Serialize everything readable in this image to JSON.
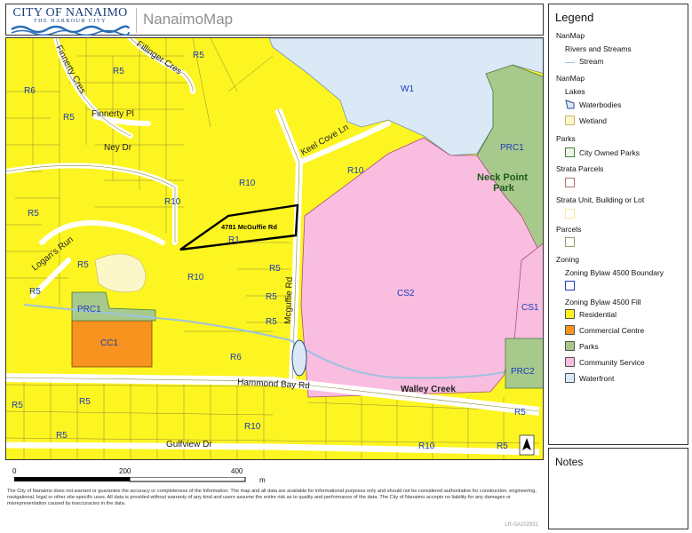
{
  "header": {
    "logo_title": "CITY OF NANAIMO",
    "logo_subtitle": "THE HARBOUR CITY",
    "app_title": "NanaimoMap"
  },
  "map": {
    "zone_labels": [
      {
        "id": "r5-top",
        "text": "R5"
      },
      {
        "id": "r6",
        "text": "R6"
      },
      {
        "id": "r5-left",
        "text": "R5"
      },
      {
        "id": "r5-a",
        "text": "R5"
      },
      {
        "id": "r10-center",
        "text": "R10"
      },
      {
        "id": "r10-mid",
        "text": "R10"
      },
      {
        "id": "r10-keel",
        "text": "R10"
      },
      {
        "id": "r1",
        "text": "R1"
      },
      {
        "id": "r5-logan",
        "text": "R5"
      },
      {
        "id": "r5-b",
        "text": "R5"
      },
      {
        "id": "r5-c",
        "text": "R5"
      },
      {
        "id": "r10-lower",
        "text": "R10"
      },
      {
        "id": "r5-mcg1",
        "text": "R5"
      },
      {
        "id": "r5-mcg2",
        "text": "R5"
      },
      {
        "id": "r5-mcg3",
        "text": "R5"
      },
      {
        "id": "r6-lower",
        "text": "R6"
      },
      {
        "id": "cc1",
        "text": "CC1"
      },
      {
        "id": "prc1-left",
        "text": "PRC1"
      },
      {
        "id": "cs2",
        "text": "CS2"
      },
      {
        "id": "cs1",
        "text": "CS1"
      },
      {
        "id": "prc2",
        "text": "PRC2"
      },
      {
        "id": "w1",
        "text": "W1"
      },
      {
        "id": "prc1-right",
        "text": "PRC1"
      },
      {
        "id": "r5-bl1",
        "text": "R5"
      },
      {
        "id": "r5-bl2",
        "text": "R5"
      },
      {
        "id": "r5-bl3",
        "text": "R5"
      },
      {
        "id": "r10-gulf",
        "text": "R10"
      },
      {
        "id": "r10-br",
        "text": "R10"
      },
      {
        "id": "r5-br",
        "text": "R5"
      },
      {
        "id": "r5-br2",
        "text": "R5"
      }
    ],
    "street_labels": [
      {
        "id": "finnerty-cres",
        "text": "Finnerty Cres"
      },
      {
        "id": "fillinger-cres",
        "text": "Fillinger Cres"
      },
      {
        "id": "finnerty-pl",
        "text": "Finnerty Pl"
      },
      {
        "id": "ney-dr",
        "text": "Ney Dr"
      },
      {
        "id": "keel-cove-ln",
        "text": "Keel Cove Ln"
      },
      {
        "id": "logans-run",
        "text": "Logan's Run"
      },
      {
        "id": "mcguffie-rd",
        "text": "Mcguffie Rd"
      },
      {
        "id": "hammond-bay-rd",
        "text": "Hammond Bay Rd"
      },
      {
        "id": "gulfview-dr",
        "text": "Gulfview Dr"
      },
      {
        "id": "walley-creek",
        "text": "Walley Creek"
      }
    ],
    "park_label": "Neck Point\nPark",
    "parcel_label": "4781 McGuffie Rd",
    "north_arrow": "north-arrow-icon"
  },
  "legend": {
    "title": "Legend",
    "group_nanmap_1": "NanMap",
    "rivers_label": "Rivers and Streams",
    "stream_label": "Stream",
    "group_nanmap_2": "NanMap",
    "lakes_label": "Lakes",
    "waterbodies_label": "Waterbodies",
    "wetland_label": "Wetland",
    "parks_group": "Parks",
    "city_parks_label": "City Owned Parks",
    "strata_parcels_label": "Strata Parcels",
    "strata_unit_label": "Strata Unit, Building or Lot",
    "parcels_label": "Parcels",
    "zoning_group": "Zoning",
    "zoning_boundary_label": "Zoning Bylaw 4500 Boundary",
    "zoning_fill_label": "Zoning Bylaw 4500 Fill",
    "residential_label": "Residential",
    "commercial_label": "Commercial Centre",
    "parks_fill_label": "Parks",
    "community_label": "Community Service",
    "waterfront_label": "Waterfront",
    "colors": {
      "residential": "#fdf521",
      "commercial": "#f7931e",
      "parks": "#a8c98c",
      "community": "#f9bde0",
      "waterfront": "#dbe9f6",
      "stream": "#9ec3de"
    }
  },
  "notes": {
    "title": "Notes"
  },
  "footer": {
    "scale_0": "0",
    "scale_200": "200",
    "scale_400": "400",
    "scale_unit": "m",
    "disclaimer": "The City of Nanaimo does not warrant or guarantee the accuracy or completeness of the Information. The map and all data are available for informational purposes only and should not be considered authoritative for construction, engineering, navigational, legal or other site-specific uses. All data is provided without warranty of any kind and users assume the entire risk as to quality and performance of the data. The City of Nanaimo accepts no liability for any damages or misrepresentation caused by inaccuracies in the data.",
    "doc_id": "LR-SA102931"
  }
}
